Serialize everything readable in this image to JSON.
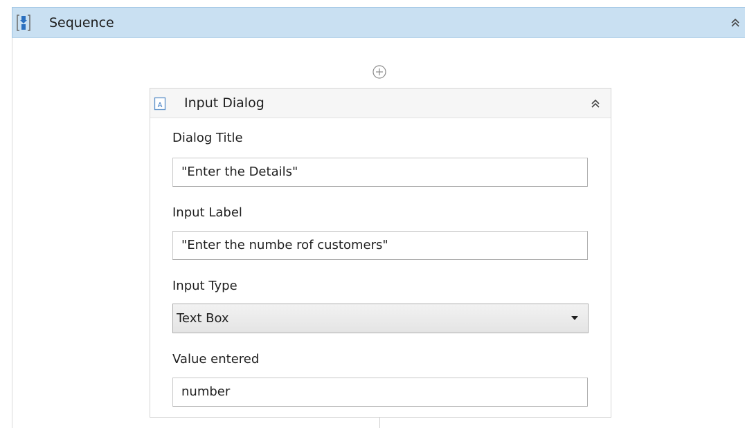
{
  "sequence": {
    "title": "Sequence",
    "header_color": "#c9e0f2",
    "icon": "sequence-icon",
    "collapse_icon": "double-chevron-up-icon"
  },
  "add_activity": {
    "icon": "plus-circle-icon"
  },
  "input_dialog": {
    "title": "Input Dialog",
    "icon": "input-dialog-icon",
    "collapse_icon": "double-chevron-up-icon",
    "fields": {
      "dialog_title": {
        "label": "Dialog Title",
        "value": "\"Enter the Details\""
      },
      "input_label": {
        "label": "Input Label",
        "value": "\"Enter the numbe rof customers\""
      },
      "input_type": {
        "label": "Input Type",
        "selected": "Text Box"
      },
      "value_entered": {
        "label": "Value entered",
        "value": "number"
      }
    }
  }
}
